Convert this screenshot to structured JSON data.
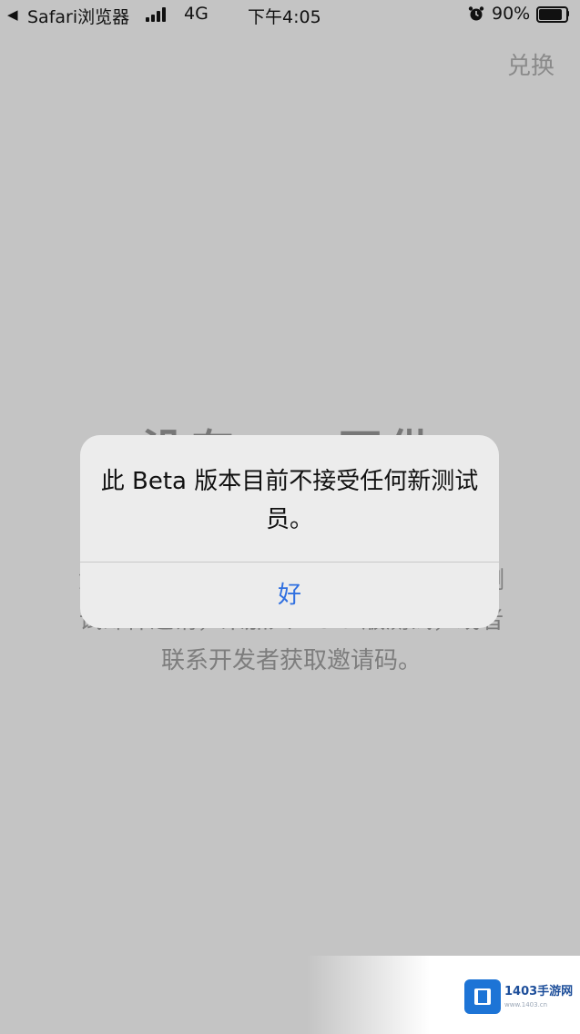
{
  "status_bar": {
    "back_app": "Safari浏览器",
    "network": "4G",
    "time": "下午4:05",
    "battery_percent": "90%",
    "battery_level": 0.9
  },
  "header": {
    "redeem_label": "兑换"
  },
  "background": {
    "heading": "没有……可供",
    "description": "您可以在使用邮件中的……去……受邀测试邮件邀请，来加入 Beta 版测试，或者联系开发者获取邀请码。"
  },
  "alert": {
    "message": "此 Beta 版本目前不接受任何新测试员。",
    "ok_label": "好"
  },
  "watermark": {
    "brand": "1403手游网",
    "url": "www.1403.cn"
  },
  "colors": {
    "overlay_bg": "#c4c4c4",
    "alert_bg": "#ececec",
    "accent": "#2f6fe0",
    "watermark_blue": "#1d74d6"
  }
}
